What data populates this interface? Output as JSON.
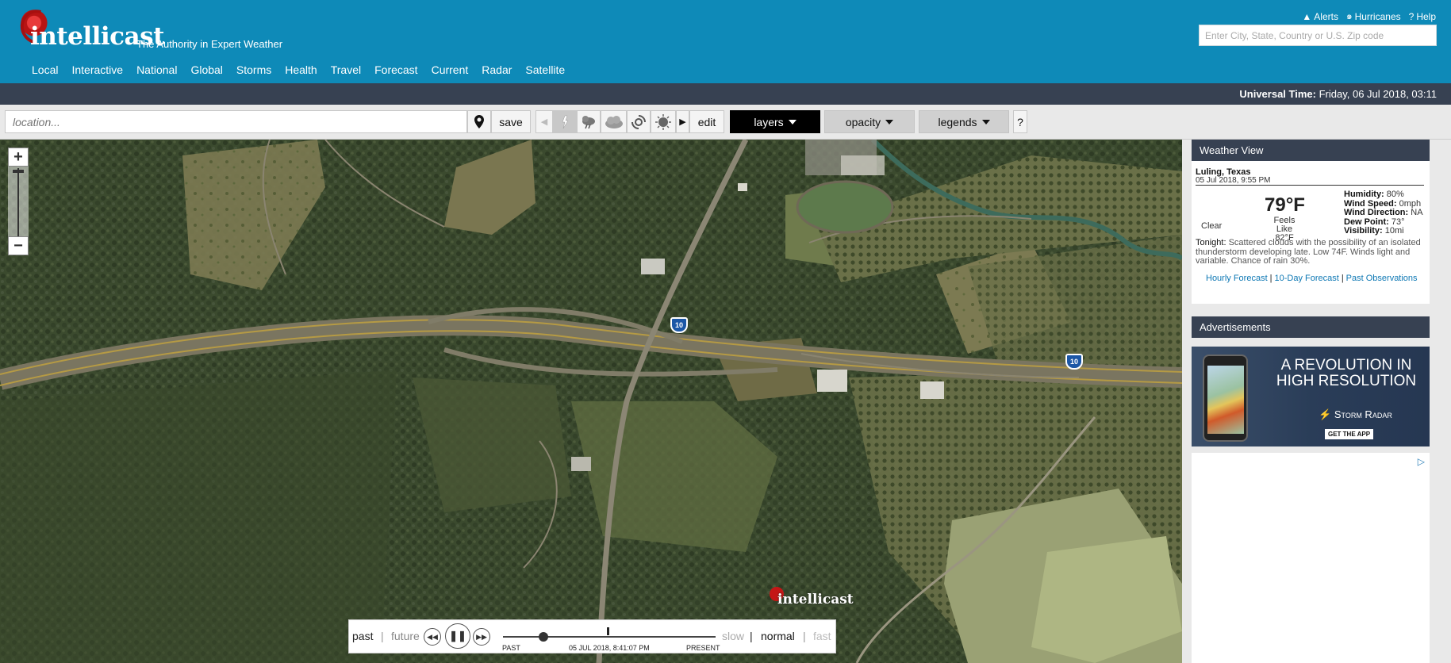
{
  "header": {
    "logo_text": "intellicast",
    "tagline": "The Authority in Expert Weather",
    "nav": [
      "Local",
      "Interactive",
      "National",
      "Global",
      "Storms",
      "Health",
      "Travel",
      "Forecast",
      "Current",
      "Radar",
      "Satellite"
    ],
    "links": {
      "alerts": "Alerts",
      "hurricanes": "Hurricanes",
      "help": "Help"
    },
    "search_placeholder": "Enter City, State, Country or U.S. Zip code"
  },
  "timebar": {
    "label": "Universal Time:",
    "value": "Friday, 06 Jul 2018, 03:11"
  },
  "toolbar": {
    "location_placeholder": "location...",
    "save": "save",
    "edit": "edit",
    "layers": "layers",
    "opacity": "opacity",
    "legends": "legends",
    "help": "?"
  },
  "map": {
    "highway_shields": [
      "10",
      "10"
    ],
    "watermark": "intellicast",
    "zoom_in": "+",
    "zoom_out": "−"
  },
  "player": {
    "past": "past",
    "future": "future",
    "sep": "|",
    "track_past": "PAST",
    "track_time": "05 JUL 2018, 8:41:07 PM",
    "track_present": "PRESENT",
    "slow": "slow",
    "normal": "normal",
    "fast": "fast",
    "progress": 0.19
  },
  "weather_view": {
    "title": "Weather View",
    "city": "Luling, Texas",
    "date": "05 Jul 2018, 9:55 PM",
    "condition": "Clear",
    "temp": "79°F",
    "feels_label": "Feels Like",
    "feels_value": "82°F",
    "stats": [
      {
        "label": "Humidity:",
        "value": "80%"
      },
      {
        "label": "Wind Speed:",
        "value": "0mph"
      },
      {
        "label": "Wind Direction:",
        "value": "NA"
      },
      {
        "label": "Dew Point:",
        "value": "73°"
      },
      {
        "label": "Visibility:",
        "value": "10mi"
      }
    ],
    "tonight_label": "Tonight:",
    "tonight_text": "Scattered clouds with the possibility of an isolated thunderstorm developing late. Low 74F. Winds light and variable. Chance of rain 30%.",
    "links": [
      "Hourly Forecast",
      "10-Day Forecast",
      "Past Observations"
    ]
  },
  "ads": {
    "title": "Advertisements",
    "headline": "A REVOLUTION IN HIGH RESOLUTION",
    "brand": "Storm Radar",
    "cta": "GET THE APP"
  },
  "colors": {
    "header": "#0e8ab8",
    "dark_bar": "#374152",
    "link": "#0e78b4"
  }
}
